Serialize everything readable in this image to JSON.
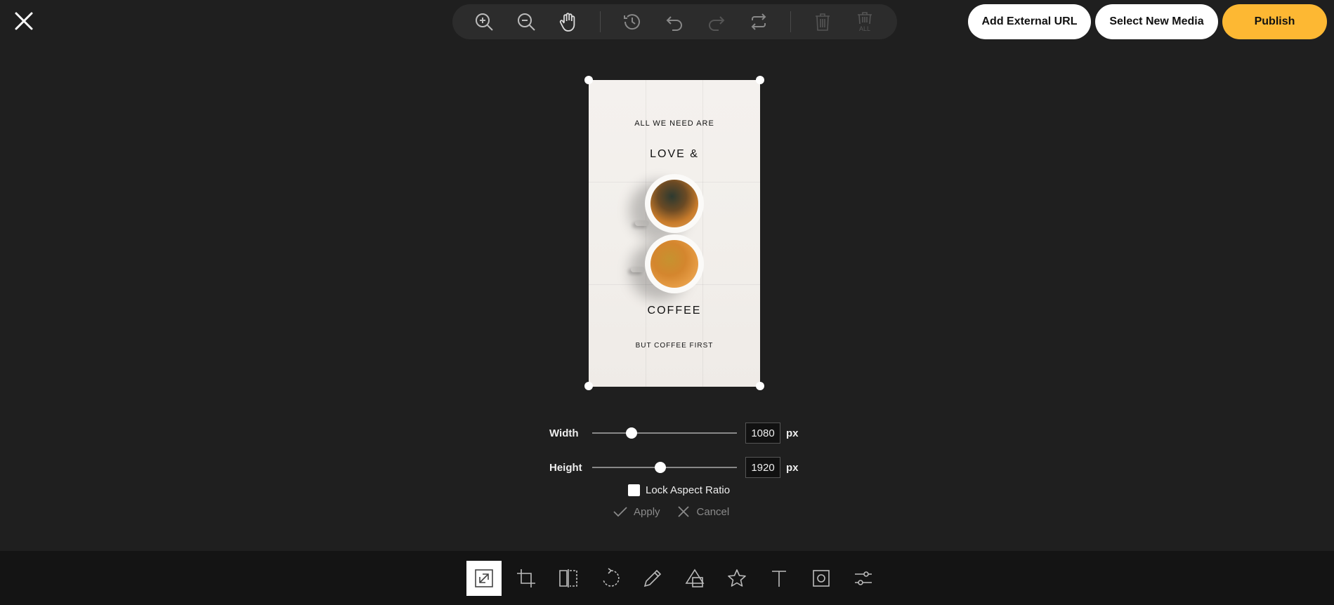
{
  "top_bar": {
    "add_external_url": "Add External URL",
    "select_new_media": "Select New Media",
    "publish": "Publish",
    "colors": {
      "publish_bg": "#fdb833",
      "button_bg": "#ffffff"
    },
    "toolbar_icons": [
      "zoom-in-icon",
      "zoom-out-icon",
      "pan-hand-icon",
      "history-icon",
      "undo-icon",
      "redo-icon",
      "reset-icon",
      "delete-icon",
      "delete-all-icon"
    ],
    "delete_all_icon_text": "ALL"
  },
  "image": {
    "line1": "ALL WE NEED ARE",
    "line2": "LOVE &",
    "line3": "COFFEE",
    "line4": "BUT COFFEE FIRST"
  },
  "resize": {
    "width_label": "Width",
    "width_value": "1080",
    "width_slider_fraction": 0.27,
    "height_label": "Height",
    "height_value": "1920",
    "height_slider_fraction": 0.47,
    "unit": "px",
    "lock_aspect_ratio_label": "Lock Aspect Ratio",
    "lock_aspect_ratio_checked": false,
    "apply_label": "Apply",
    "cancel_label": "Cancel"
  },
  "bottom_tools": [
    "resize-icon",
    "crop-icon",
    "flip-icon",
    "rotate-icon",
    "draw-icon",
    "shapes-icon",
    "sticker-star-icon",
    "text-icon",
    "frame-icon",
    "adjust-filters-icon"
  ],
  "active_tool": "resize-icon"
}
